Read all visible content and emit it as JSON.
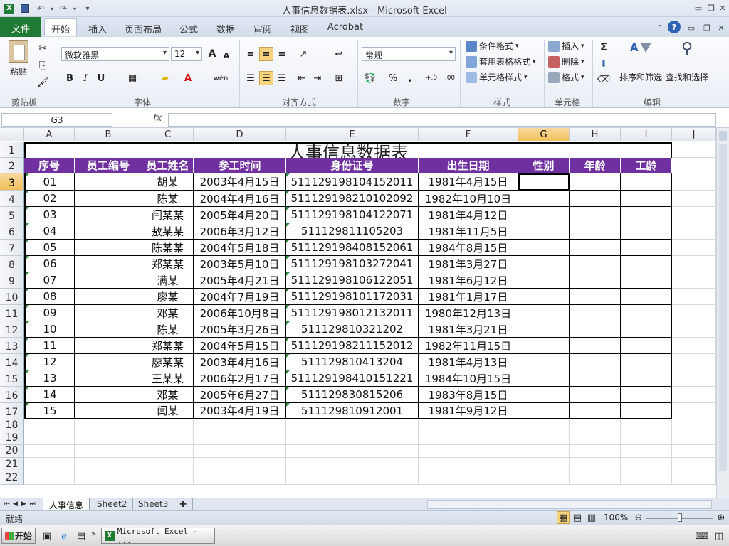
{
  "window": {
    "title": "人事信息数据表.xlsx - Microsoft Excel",
    "min_icon": "minimize-icon",
    "restore_icon": "restore-icon",
    "close_icon": "close-icon"
  },
  "tabs": [
    "文件",
    "开始",
    "插入",
    "页面布局",
    "公式",
    "数据",
    "审阅",
    "视图",
    "Acrobat"
  ],
  "ribbon": {
    "clipboard": {
      "paste": "粘贴",
      "label": "剪贴板"
    },
    "font": {
      "name": "微软雅黑",
      "size": "12",
      "label": "字体",
      "bold": "B",
      "italic": "I",
      "underline": "U",
      "grow": "A",
      "shrink": "A",
      "phonetic": "wén"
    },
    "alignment": {
      "label": "对齐方式"
    },
    "number": {
      "format": "常规",
      "percent": "%",
      "comma": ",",
      "inc_dec": "+.0",
      "dec_dec": ".00",
      "label": "数字"
    },
    "styles": {
      "cond": "条件格式",
      "table": "套用表格格式",
      "cell": "单元格样式",
      "label": "样式"
    },
    "cells": {
      "insert": "插入",
      "delete": "删除",
      "format": "格式",
      "label": "单元格"
    },
    "editing": {
      "sort": "排序和筛选",
      "find": "查找和选择",
      "label": "编辑",
      "sigma": "Σ"
    }
  },
  "formula_bar": {
    "name_box": "G3",
    "fx": "fx",
    "content": ""
  },
  "columns": [
    "A",
    "B",
    "C",
    "D",
    "E",
    "F",
    "G",
    "H",
    "I",
    "J"
  ],
  "rows": [
    "1",
    "2",
    "3",
    "4",
    "5",
    "6",
    "7",
    "8",
    "9",
    "10",
    "11",
    "12",
    "13",
    "14",
    "15",
    "16",
    "17",
    "18",
    "19",
    "20",
    "21",
    "22"
  ],
  "sheet": {
    "title": "人事信息数据表",
    "headers": [
      "序号",
      "员工编号",
      "员工姓名",
      "参工时间",
      "身份证号",
      "出生日期",
      "性别",
      "年龄",
      "工龄"
    ],
    "data": [
      [
        "01",
        "",
        "胡某",
        "2003年4月15日",
        "511129198104152011",
        "1981年4月15日",
        "",
        "",
        ""
      ],
      [
        "02",
        "",
        "陈某",
        "2004年4月16日",
        "511129198210102092",
        "1982年10月10日",
        "",
        "",
        ""
      ],
      [
        "03",
        "",
        "闫某某",
        "2005年4月20日",
        "511129198104122071",
        "1981年4月12日",
        "",
        "",
        ""
      ],
      [
        "04",
        "",
        "敖某某",
        "2006年3月12日",
        "511129811105203",
        "1981年11月5日",
        "",
        "",
        ""
      ],
      [
        "05",
        "",
        "陈某某",
        "2004年5月18日",
        "511129198408152061",
        "1984年8月15日",
        "",
        "",
        ""
      ],
      [
        "06",
        "",
        "郑某某",
        "2003年5月10日",
        "511129198103272041",
        "1981年3月27日",
        "",
        "",
        ""
      ],
      [
        "07",
        "",
        "满某",
        "2005年4月21日",
        "511129198106122051",
        "1981年6月12日",
        "",
        "",
        ""
      ],
      [
        "08",
        "",
        "廖某",
        "2004年7月19日",
        "511129198101172031",
        "1981年1月17日",
        "",
        "",
        ""
      ],
      [
        "09",
        "",
        "邓某",
        "2006年10月8日",
        "511129198012132011",
        "1980年12月13日",
        "",
        "",
        ""
      ],
      [
        "10",
        "",
        "陈某",
        "2005年3月26日",
        "511129810321202",
        "1981年3月21日",
        "",
        "",
        ""
      ],
      [
        "11",
        "",
        "郑某某",
        "2004年5月15日",
        "511129198211152012",
        "1982年11月15日",
        "",
        "",
        ""
      ],
      [
        "12",
        "",
        "廖某某",
        "2003年4月16日",
        "511129810413204",
        "1981年4月13日",
        "",
        "",
        ""
      ],
      [
        "13",
        "",
        "王某某",
        "2006年2月17日",
        "511129198410151221",
        "1984年10月15日",
        "",
        "",
        ""
      ],
      [
        "14",
        "",
        "邓某",
        "2005年6月27日",
        "511129830815206",
        "1983年8月15日",
        "",
        "",
        ""
      ],
      [
        "15",
        "",
        "闫某",
        "2003年4月19日",
        "511129810912001",
        "1981年9月12日",
        "",
        "",
        ""
      ]
    ]
  },
  "sheet_tabs": [
    "人事信息",
    "Sheet2",
    "Sheet3"
  ],
  "status": {
    "ready": "就绪",
    "zoom": "100%"
  },
  "taskbar": {
    "start": "开始",
    "app": "Microsoft Excel - ..."
  },
  "colors": {
    "header_bg": "#7030a0",
    "accent": "#1f7a33",
    "selection": "#f1c05c"
  }
}
